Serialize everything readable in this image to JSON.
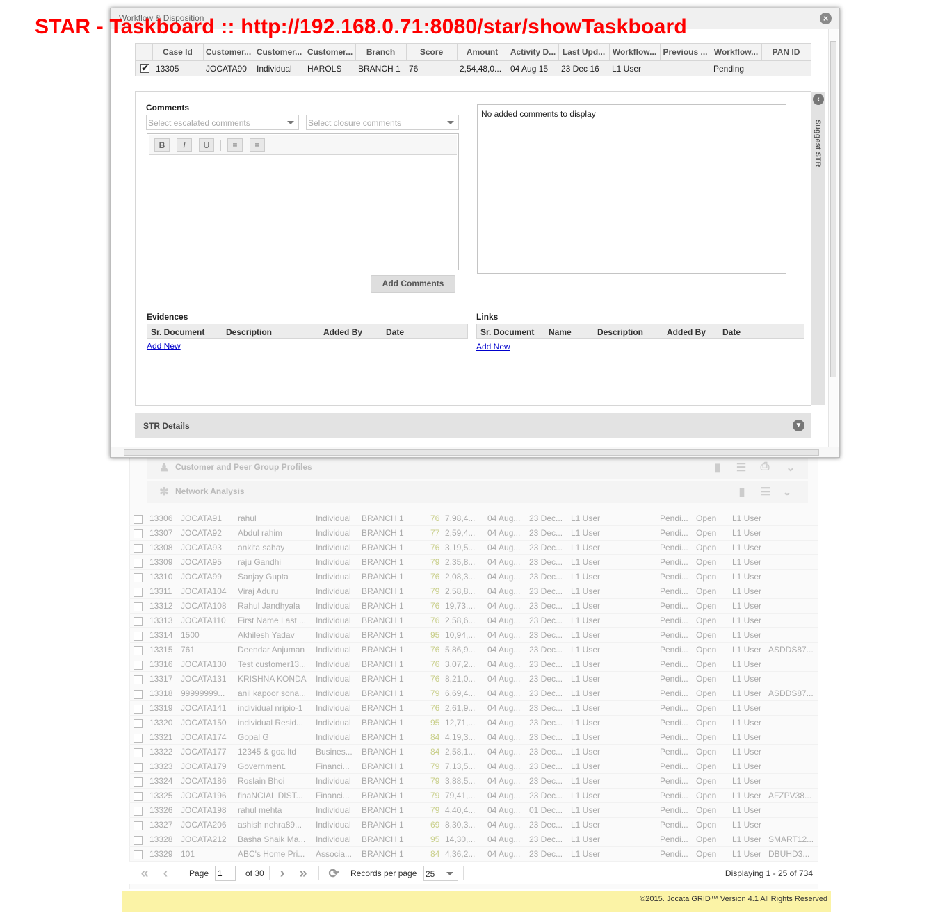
{
  "banner": {
    "text": "STAR - Taskboard :: http://192.168.0.71:8080/star/showTaskboard"
  },
  "modal": {
    "title": "Workflow & Disposition",
    "close_icon": "close-icon",
    "case_headers": [
      "Case Id",
      "Customer...",
      "Customer...",
      "Customer...",
      "Branch",
      "Score",
      "Amount",
      "Activity D...",
      "Last Upd...",
      "Workflow...",
      "Previous ...",
      "Workflow...",
      "PAN ID"
    ],
    "case_row": {
      "checked": "✔",
      "case_id": "13305",
      "customer_id": "JOCATA90",
      "customer_type": "Individual",
      "customer_name": "HAROLS",
      "branch": "BRANCH 1",
      "score": "76",
      "amount": "2,54,48,0...",
      "activity_date": "04 Aug 15",
      "last_updated": "23 Dec 16",
      "workflow": "L1 User",
      "previous": "",
      "workflow_status": "Pending",
      "pan_id": ""
    },
    "comments": {
      "label": "Comments",
      "escalated_placeholder": "Select escalated comments",
      "closure_placeholder": "Select closure comments",
      "toolbar": {
        "bold": "B",
        "italic": "I",
        "underline": "U",
        "ordered": "≡",
        "unordered": "≡"
      },
      "empty_text": "No added comments to display",
      "add_button": "Add Comments"
    },
    "side_tab": "Suggest STR",
    "evidences": {
      "label": "Evidences",
      "headers": [
        "Sr. Document",
        "Description",
        "Added By",
        "Date"
      ],
      "add_new": "Add New"
    },
    "links": {
      "label": "Links",
      "headers": [
        "Sr. Document",
        "Name",
        "Description",
        "Added By",
        "Date"
      ],
      "add_new": "Add New"
    },
    "str_details": "STR Details"
  },
  "background": {
    "profiles": [
      {
        "label": "Customer and Peer Group Profiles",
        "icon": "users-icon"
      },
      {
        "label": "Network Analysis",
        "icon": "network-icon"
      }
    ],
    "rows": [
      [
        "13306",
        "JOCATA91",
        "rahul",
        "Individual",
        "BRANCH 1",
        "76",
        "7,98,4...",
        "04 Aug...",
        "23 Dec...",
        "L1 User",
        "Pendi...",
        "Open",
        "L1 User",
        ""
      ],
      [
        "13307",
        "JOCATA92",
        "Abdul rahim",
        "Individual",
        "BRANCH 1",
        "77",
        "2,59,4...",
        "04 Aug...",
        "23 Dec...",
        "L1 User",
        "Pendi...",
        "Open",
        "L1 User",
        ""
      ],
      [
        "13308",
        "JOCATA93",
        "ankita sahay",
        "Individual",
        "BRANCH 1",
        "76",
        "3,19,5...",
        "04 Aug...",
        "23 Dec...",
        "L1 User",
        "Pendi...",
        "Open",
        "L1 User",
        ""
      ],
      [
        "13309",
        "JOCATA95",
        "raju Gandhi",
        "Individual",
        "BRANCH 1",
        "79",
        "2,35,8...",
        "04 Aug...",
        "23 Dec...",
        "L1 User",
        "Pendi...",
        "Open",
        "L1 User",
        ""
      ],
      [
        "13310",
        "JOCATA99",
        "Sanjay Gupta",
        "Individual",
        "BRANCH 1",
        "76",
        "2,08,3...",
        "04 Aug...",
        "23 Dec...",
        "L1 User",
        "Pendi...",
        "Open",
        "L1 User",
        ""
      ],
      [
        "13311",
        "JOCATA104",
        "Viraj Aduru",
        "Individual",
        "BRANCH 1",
        "79",
        "2,58,8...",
        "04 Aug...",
        "23 Dec...",
        "L1 User",
        "Pendi...",
        "Open",
        "L1 User",
        ""
      ],
      [
        "13312",
        "JOCATA108",
        "Rahul Jandhyala",
        "Individual",
        "BRANCH 1",
        "76",
        "19,73,...",
        "04 Aug...",
        "23 Dec...",
        "L1 User",
        "Pendi...",
        "Open",
        "L1 User",
        ""
      ],
      [
        "13313",
        "JOCATA110",
        "First Name Last ...",
        "Individual",
        "BRANCH 1",
        "76",
        "2,58,6...",
        "04 Aug...",
        "23 Dec...",
        "L1 User",
        "Pendi...",
        "Open",
        "L1 User",
        ""
      ],
      [
        "13314",
        "1500",
        "Akhilesh Yadav",
        "Individual",
        "BRANCH 1",
        "95",
        "10,94,...",
        "04 Aug...",
        "23 Dec...",
        "L1 User",
        "Pendi...",
        "Open",
        "L1 User",
        ""
      ],
      [
        "13315",
        "761",
        "Deendar Anjuman",
        "Individual",
        "BRANCH 1",
        "76",
        "5,86,9...",
        "04 Aug...",
        "23 Dec...",
        "L1 User",
        "Pendi...",
        "Open",
        "L1 User",
        "ASDDS87..."
      ],
      [
        "13316",
        "JOCATA130",
        "Test customer13...",
        "Individual",
        "BRANCH 1",
        "76",
        "3,07,2...",
        "04 Aug...",
        "23 Dec...",
        "L1 User",
        "Pendi...",
        "Open",
        "L1 User",
        ""
      ],
      [
        "13317",
        "JOCATA131",
        "KRISHNA KONDA",
        "Individual",
        "BRANCH 1",
        "76",
        "8,21,0...",
        "04 Aug...",
        "23 Dec...",
        "L1 User",
        "Pendi...",
        "Open",
        "L1 User",
        ""
      ],
      [
        "13318",
        "99999999...",
        "anil kapoor sona...",
        "Individual",
        "BRANCH 1",
        "79",
        "6,69,4...",
        "04 Aug...",
        "23 Dec...",
        "L1 User",
        "Pendi...",
        "Open",
        "L1 User",
        "ASDDS87..."
      ],
      [
        "13319",
        "JOCATA141",
        "individual nripio-1",
        "Individual",
        "BRANCH 1",
        "76",
        "2,61,9...",
        "04 Aug...",
        "23 Dec...",
        "L1 User",
        "Pendi...",
        "Open",
        "L1 User",
        ""
      ],
      [
        "13320",
        "JOCATA150",
        "individual Resid...",
        "Individual",
        "BRANCH 1",
        "95",
        "12,71,...",
        "04 Aug...",
        "23 Dec...",
        "L1 User",
        "Pendi...",
        "Open",
        "L1 User",
        ""
      ],
      [
        "13321",
        "JOCATA174",
        "Gopal G",
        "Individual",
        "BRANCH 1",
        "84",
        "4,19,3...",
        "04 Aug...",
        "23 Dec...",
        "L1 User",
        "Pendi...",
        "Open",
        "L1 User",
        ""
      ],
      [
        "13322",
        "JOCATA177",
        "12345 & goa ltd",
        "Busines...",
        "BRANCH 1",
        "84",
        "2,58,1...",
        "04 Aug...",
        "23 Dec...",
        "L1 User",
        "Pendi...",
        "Open",
        "L1 User",
        ""
      ],
      [
        "13323",
        "JOCATA179",
        "Government.",
        "Financi...",
        "BRANCH 1",
        "79",
        "7,13,5...",
        "04 Aug...",
        "23 Dec...",
        "L1 User",
        "Pendi...",
        "Open",
        "L1 User",
        ""
      ],
      [
        "13324",
        "JOCATA186",
        "Roslain Bhoi",
        "Individual",
        "BRANCH 1",
        "79",
        "3,88,5...",
        "04 Aug...",
        "23 Dec...",
        "L1 User",
        "Pendi...",
        "Open",
        "L1 User",
        ""
      ],
      [
        "13325",
        "JOCATA196",
        "finaNCIAL DIST...",
        "Financi...",
        "BRANCH 1",
        "79",
        "79,41,...",
        "04 Aug...",
        "23 Dec...",
        "L1 User",
        "Pendi...",
        "Open",
        "L1 User",
        "AFZPV38..."
      ],
      [
        "13326",
        "JOCATA198",
        "rahul mehta",
        "Individual",
        "BRANCH 1",
        "79",
        "4,40,4...",
        "04 Aug...",
        "01 Dec...",
        "L1 User",
        "Pendi...",
        "Open",
        "L1 User",
        ""
      ],
      [
        "13327",
        "JOCATA206",
        "ashish nehra89...",
        "Individual",
        "BRANCH 1",
        "69",
        "8,30,3...",
        "04 Aug...",
        "23 Dec...",
        "L1 User",
        "Pendi...",
        "Open",
        "L1 User",
        ""
      ],
      [
        "13328",
        "JOCATA212",
        "Basha Shaik Ma...",
        "Individual",
        "BRANCH 1",
        "95",
        "14,30,...",
        "04 Aug...",
        "23 Dec...",
        "L1 User",
        "Pendi...",
        "Open",
        "L1 User",
        "SMART12..."
      ],
      [
        "13329",
        "101",
        "ABC's Home Pri...",
        "Associa...",
        "BRANCH 1",
        "84",
        "4,36,2...",
        "04 Aug...",
        "23 Dec...",
        "L1 User",
        "Pendi...",
        "Open",
        "L1 User",
        "DBUHD3..."
      ]
    ]
  },
  "pager": {
    "page_label": "Page",
    "page_value": "1",
    "of_label": "of 30",
    "records_label": "Records per page",
    "records_value": "25",
    "displaying": "Displaying 1 - 25 of 734"
  },
  "footer": {
    "text": "©2015. Jocata GRID™ Version 4.1 All Rights Reserved"
  }
}
